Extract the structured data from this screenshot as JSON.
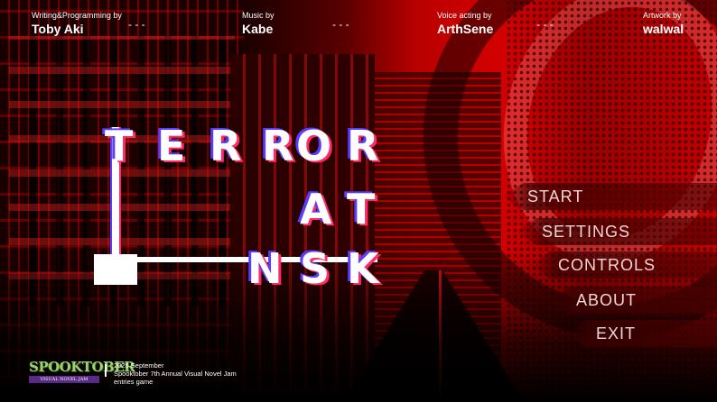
{
  "credits": [
    {
      "role": "Writing&Programming by",
      "name": "Toby Aki"
    },
    {
      "role": "Music by",
      "name": "Kabe"
    },
    {
      "role": "Voice acting by",
      "name": "ArthSene"
    },
    {
      "role": "Artwork by",
      "name": "walwal"
    }
  ],
  "separator": "-   -   -",
  "title": {
    "row1": [
      "T",
      "E",
      "R",
      "R",
      "O",
      "R"
    ],
    "row2": [
      "A",
      "T"
    ],
    "row3": [
      "N",
      "S",
      "K"
    ]
  },
  "menu": {
    "start": "START",
    "settings": "SETTINGS",
    "controls": "CONTROLS",
    "about": "ABOUT",
    "exit": "EXIT"
  },
  "footer": {
    "logo_main": "SPOOKTOBER",
    "logo_sub": "VISUAL NOVEL JAM",
    "date": "2025 September",
    "event": "Spooktober 7th Annual Visual Novel Jam",
    "entry": "entries game"
  },
  "colors": {
    "accent_red": "#d40000",
    "glitch_blue": "#5a3cff",
    "glitch_pink": "#ff2a6a",
    "logo_green": "#9bd36a",
    "logo_purple": "#5a2a8a"
  }
}
